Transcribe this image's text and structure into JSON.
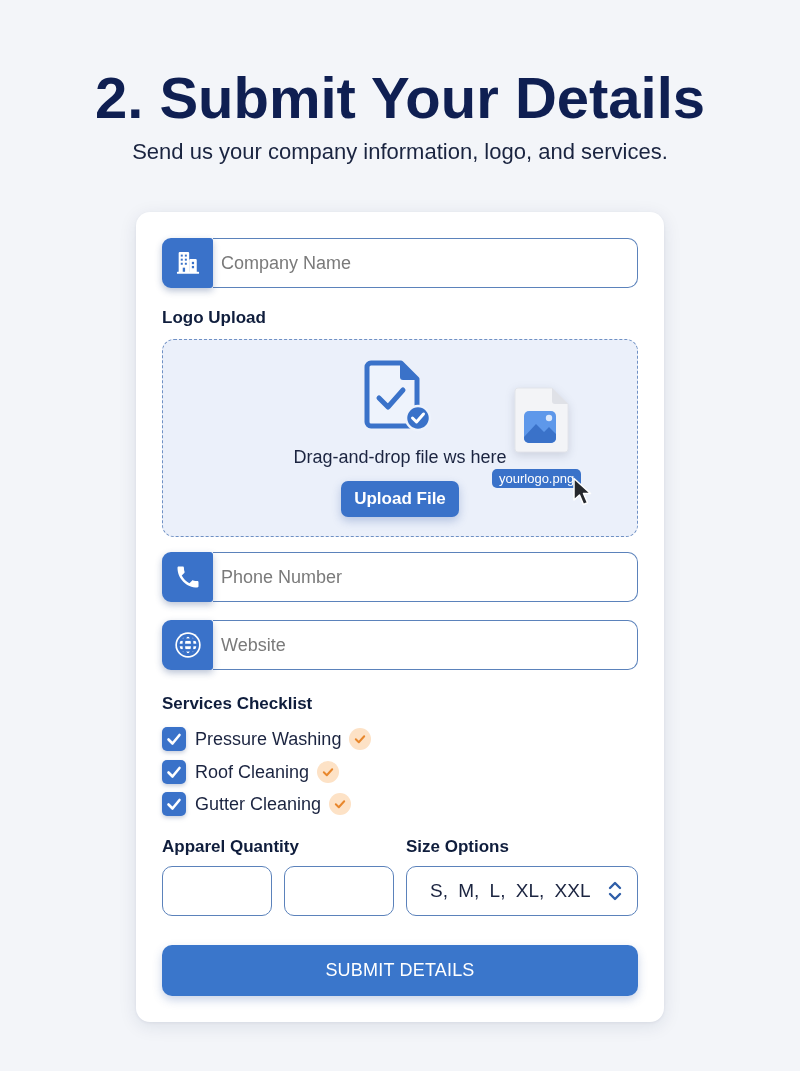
{
  "header": {
    "title": "2. Submit Your Details",
    "subtitle": "Send us your company information, logo, and services."
  },
  "company_field": {
    "placeholder": "Company Name"
  },
  "logo_upload": {
    "label": "Logo Upload",
    "prompt": "Drag-and-drop file ws here",
    "button": "Upload File",
    "dragged_file": "yourlogo.png"
  },
  "contact_fields": [
    {
      "kind": "phone",
      "placeholder": "Phone Number"
    },
    {
      "kind": "website",
      "placeholder": "Website"
    }
  ],
  "services": {
    "label": "Services Checklist",
    "items": [
      {
        "label": "Pressure Washing",
        "checked": true,
        "confirmed": true
      },
      {
        "label": "Roof Cleaning",
        "checked": true,
        "confirmed": true
      },
      {
        "label": "Gutter Cleaning",
        "checked": true,
        "confirmed": true
      }
    ]
  },
  "apparel_quantity": {
    "label": "Apparel Quantity"
  },
  "size_options": {
    "label": "Size Options",
    "value": "S, M, L, XL, XXL"
  },
  "submit_button": "SUBMIT DETAILS"
}
